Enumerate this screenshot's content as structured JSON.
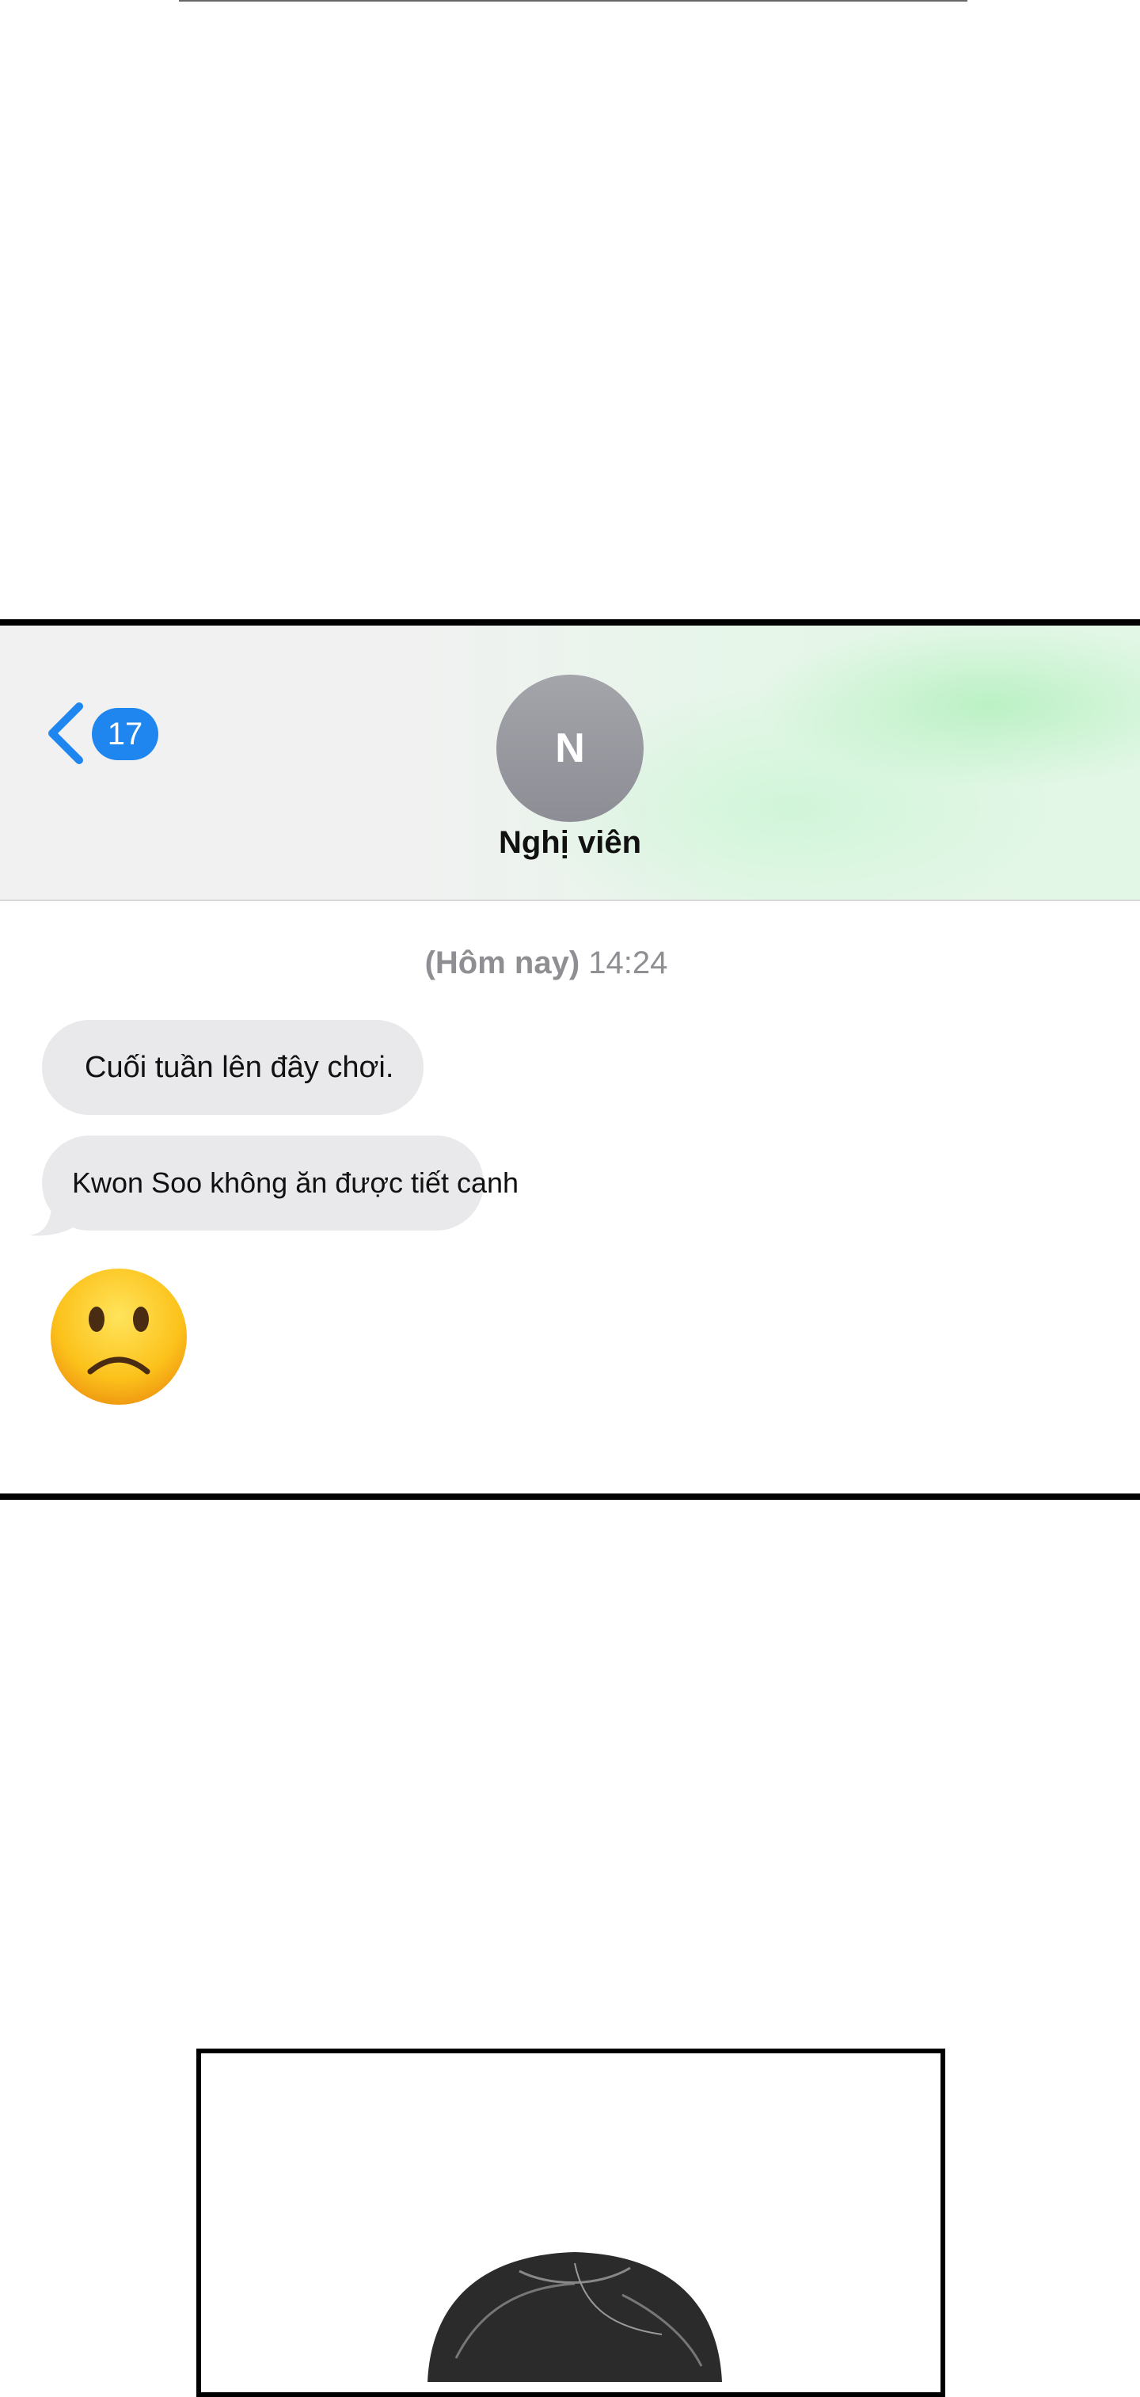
{
  "header": {
    "back_badge_count": "17",
    "avatar_initial": "N",
    "contact_name": "Nghị viên"
  },
  "conversation": {
    "timestamp_day": "(Hôm nay)",
    "timestamp_time": "14:24",
    "messages": [
      {
        "text": "Cuối tuần lên đây chơi."
      },
      {
        "text": "Kwon Soo không ăn được tiết canh"
      },
      {
        "emoji": "slightly-frowning-face"
      }
    ]
  },
  "colors": {
    "accent_blue": "#1f86ef",
    "bubble_gray": "#e9e9eb",
    "timestamp_gray": "#8e8e93"
  }
}
